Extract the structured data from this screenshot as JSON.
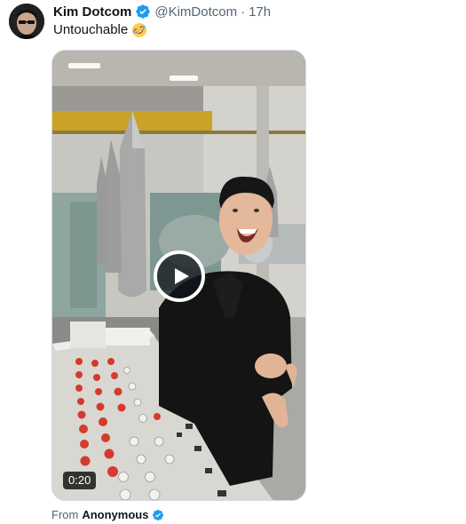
{
  "author": {
    "display_name": "Kim Dotcom",
    "handle": "@KimDotcom",
    "separator": "·",
    "time": "17h",
    "verified": true,
    "avatar_icon": "avatar-image"
  },
  "tweet": {
    "text": "Untouchable",
    "emoji_icon": "rolling-on-floor-laughing-emoji"
  },
  "media": {
    "type": "video",
    "duration": "0:20",
    "play_icon": "play-icon"
  },
  "attribution": {
    "prefix": "From",
    "source_name": "Anonymous",
    "verified": true
  },
  "colors": {
    "verified_blue": "#1d9bf0",
    "text_primary": "#0f1419",
    "text_secondary": "#536471"
  }
}
